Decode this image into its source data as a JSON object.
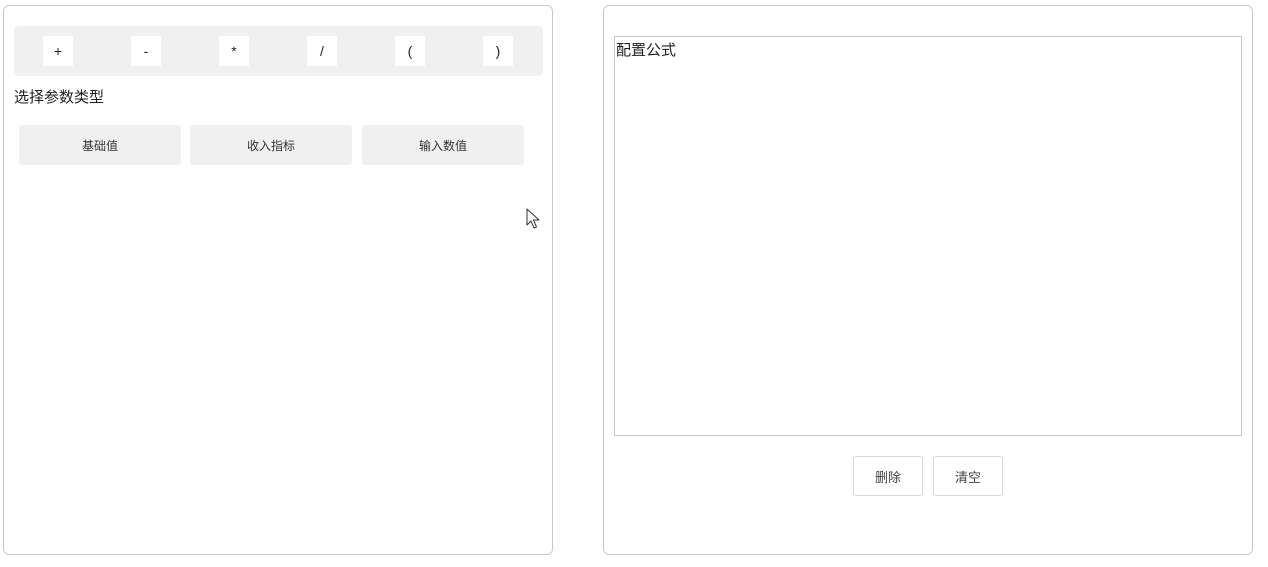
{
  "operators": [
    "+",
    "-",
    "*",
    "/",
    "(",
    ")"
  ],
  "param_section": {
    "label": "选择参数类型",
    "buttons": [
      "基础值",
      "收入指标",
      "输入数值"
    ]
  },
  "formula": {
    "placeholder": "配置公式"
  },
  "actions": {
    "delete_label": "删除",
    "clear_label": "清空"
  }
}
